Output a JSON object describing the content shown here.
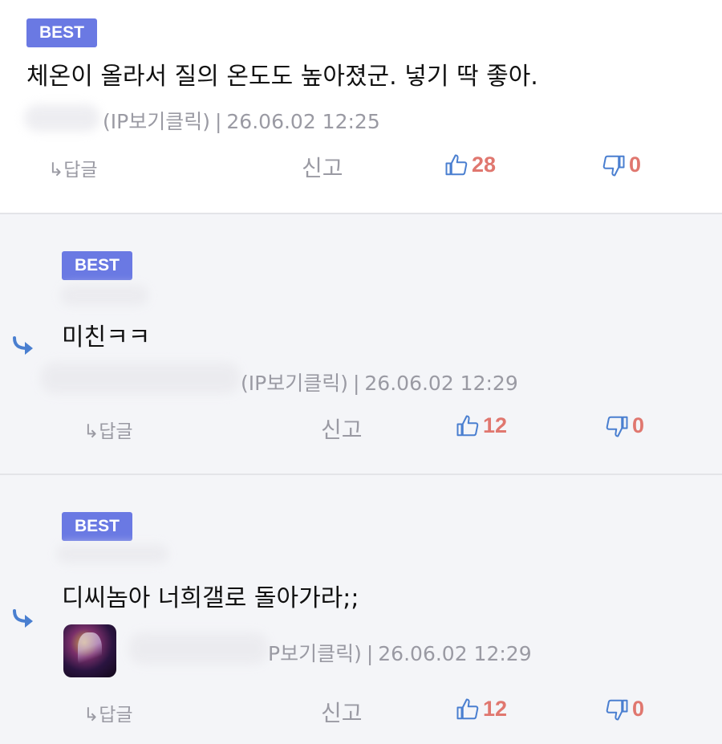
{
  "comments": [
    {
      "badge": "BEST",
      "text": "체온이 올라서 질의 온도도 높아졌군. 넣기 딱 좋아.",
      "ip_label": "(IP보기클릭)",
      "separator": "|",
      "timestamp": "26.06.02 12:25",
      "reply_label": "↳답글",
      "report_label": "신고",
      "likes": "28",
      "dislikes": "0"
    },
    {
      "badge": "BEST",
      "text": "미친ㅋㅋ",
      "ip_label": "(IP보기클릭)",
      "separator": "|",
      "timestamp": "26.06.02 12:29",
      "reply_label": "↳답글",
      "report_label": "신고",
      "likes": "12",
      "dislikes": "0"
    },
    {
      "badge": "BEST",
      "text": "디씨놈아 너희갤로 돌아가라;;",
      "ip_label": "P보기클릭)",
      "separator": "|",
      "timestamp": "26.06.02 12:29",
      "reply_label": "↳답글",
      "report_label": "신고",
      "likes": "12",
      "dislikes": "0"
    }
  ],
  "colors": {
    "badge": "#6a79e3",
    "count": "#e0776f",
    "icon_blue": "#4a7fd0",
    "reply_bg": "#f4f5f8"
  },
  "icons": [
    "reply-arrow-icon",
    "thumbs-up-icon",
    "thumbs-down-icon"
  ]
}
